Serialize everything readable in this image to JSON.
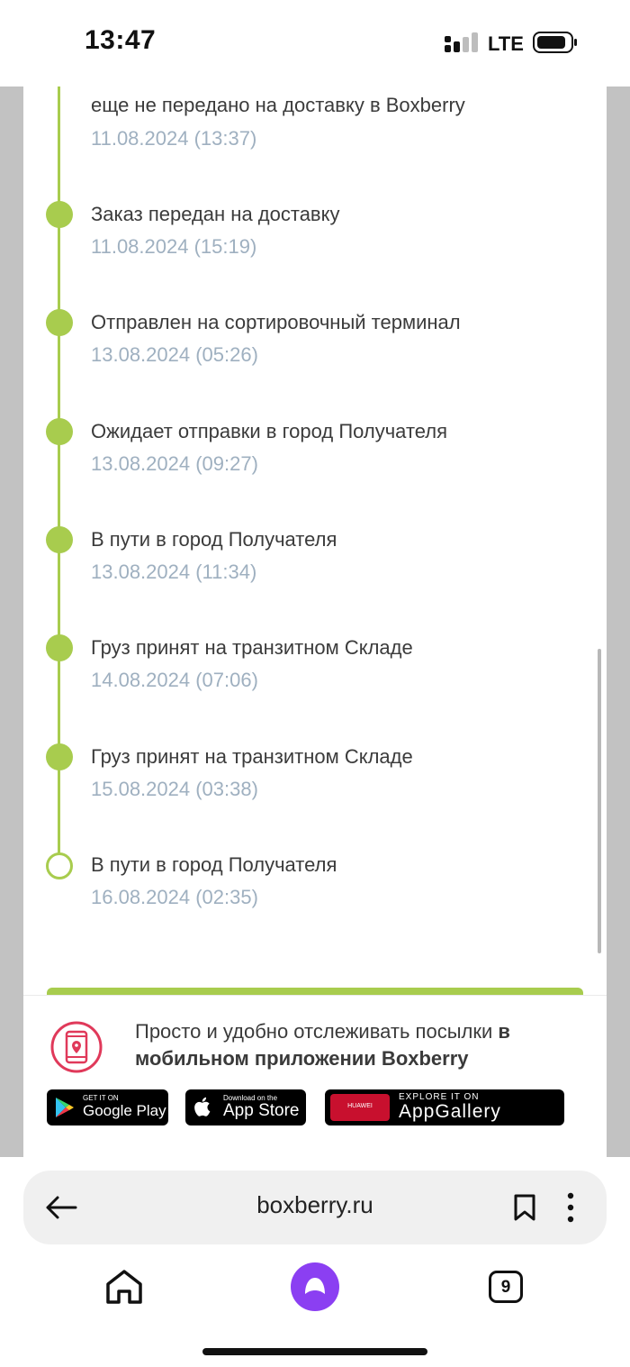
{
  "status_bar": {
    "time": "13:47",
    "network": "LTE"
  },
  "timeline": {
    "events": [
      {
        "title": "еще не передано на доставку в Boxberry",
        "date": "11.08.2024 (13:37)",
        "marker": "none"
      },
      {
        "title": "Заказ передан на доставку",
        "date": "11.08.2024 (15:19)",
        "marker": "filled"
      },
      {
        "title": "Отправлен на сортировочный терминал",
        "date": "13.08.2024 (05:26)",
        "marker": "filled"
      },
      {
        "title": "Ожидает отправки в город Получателя",
        "date": "13.08.2024 (09:27)",
        "marker": "filled"
      },
      {
        "title": "В пути в город Получателя",
        "date": "13.08.2024 (11:34)",
        "marker": "filled"
      },
      {
        "title": "Груз принят на транзитном Складе",
        "date": "14.08.2024 (07:06)",
        "marker": "filled"
      },
      {
        "title": "Груз принят на транзитном Складе",
        "date": "15.08.2024 (03:38)",
        "marker": "filled"
      },
      {
        "title": "В пути в город Получателя",
        "date": "16.08.2024 (02:35)",
        "marker": "open"
      }
    ]
  },
  "promo": {
    "text_regular": "Просто и удобно отслеживать посылки ",
    "text_bold": "в мобильном приложении Boxberry",
    "google_play": {
      "small": "GET IT ON",
      "big": "Google Play"
    },
    "app_store": {
      "small": "Download on the",
      "big": "App Store"
    },
    "app_gallery": {
      "small": "EXPLORE IT ON",
      "big": "AppGallery",
      "brand": "HUAWEI"
    }
  },
  "browser": {
    "url": "boxberry.ru",
    "tabs_count": "9"
  },
  "colors": {
    "accent_green": "#a8cc4e",
    "date_gray": "#9fb0c0",
    "alice_purple": "#8b3ff2",
    "promo_red": "#e0395a"
  }
}
